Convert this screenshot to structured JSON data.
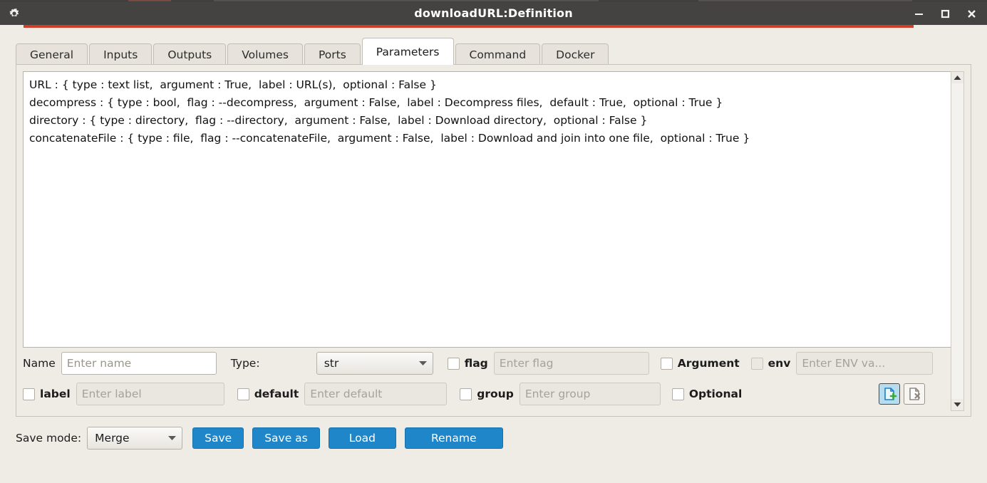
{
  "titlebar": {
    "icon": "gear-icon",
    "title": "downloadURL:Definition",
    "minimize": "—",
    "maximize": "□",
    "close": "✕",
    "accent_color": "#cf3e29",
    "background_color": "#444341"
  },
  "tabs": [
    {
      "label": "General",
      "active": false
    },
    {
      "label": "Inputs",
      "active": false
    },
    {
      "label": "Outputs",
      "active": false
    },
    {
      "label": "Volumes",
      "active": false
    },
    {
      "label": "Ports",
      "active": false
    },
    {
      "label": "Parameters",
      "active": true
    },
    {
      "label": "Command",
      "active": false
    },
    {
      "label": "Docker",
      "active": false
    }
  ],
  "editor": {
    "lines": [
      "URL : { type : text list,  argument : True,  label : URL(s),  optional : False }",
      "decompress : { type : bool,  flag : --decompress,  argument : False,  label : Decompress files,  default : True,  optional : True }",
      "directory : { type : directory,  flag : --directory,  argument : False,  label : Download directory,  optional : False }",
      "concatenateFile : { type : file,  flag : --concatenateFile,  argument : False,  label : Download and join into one file,  optional : True }"
    ]
  },
  "form": {
    "name_label": "Name",
    "name_placeholder": "Enter name",
    "name_value": "",
    "type_label": "Type:",
    "type_value": "str",
    "flag_checkbox_label": "flag",
    "flag_placeholder": "Enter flag",
    "flag_value": "",
    "argument_checkbox_label": "Argument",
    "env_checkbox_label": "env",
    "env_placeholder": "Enter ENV va...",
    "env_value": "",
    "label_checkbox_label": "label",
    "label_placeholder": "Enter label",
    "label_value": "",
    "default_checkbox_label": "default",
    "default_placeholder": "Enter default",
    "default_value": "",
    "group_checkbox_label": "group",
    "group_placeholder": "Enter group",
    "group_value": "",
    "optional_checkbox_label": "Optional",
    "add_button_icon": "add-parameter-icon",
    "delete_button_icon": "delete-parameter-icon"
  },
  "scrollbar": {
    "up_arrow": "▲",
    "down_arrow": "▼"
  },
  "bottombar": {
    "save_mode_label": "Save mode:",
    "save_mode_value": "Merge",
    "save_label": "Save",
    "save_as_label": "Save as",
    "load_label": "Load",
    "rename_label": "Rename",
    "button_color": "#1f86c9"
  }
}
